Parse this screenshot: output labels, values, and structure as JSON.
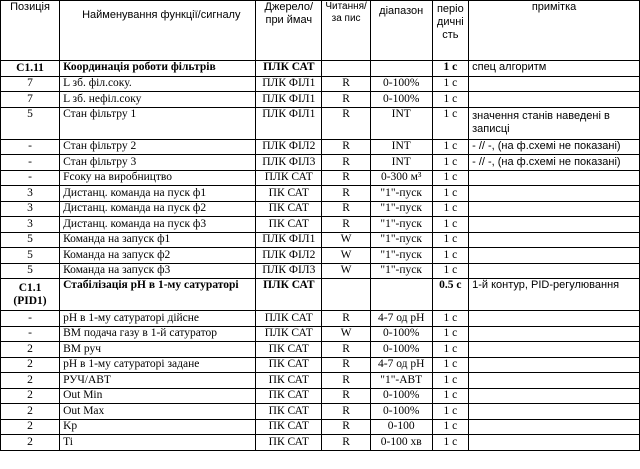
{
  "headers": {
    "position": "Позиція",
    "name": "Найменування функції/сигналу",
    "source": "Джерело/при ймач",
    "rw": "Читання/за пис",
    "range": "діапазон",
    "period": "періо дичні сть",
    "note": "примітка"
  },
  "rows": [
    {
      "pos": "С1.11",
      "name": "Координація роботи фільтрів",
      "src": "ПЛК САТ",
      "rw": "",
      "range": "",
      "per": "1 с",
      "note": "спец алгоритм",
      "section": true
    },
    {
      "pos": "7",
      "name": "L зб. філ.соку.",
      "src": "ПЛК ФІЛ1",
      "rw": "R",
      "range": "0-100%",
      "per": "1 с",
      "note": ""
    },
    {
      "pos": "7",
      "name": "L зб. нефіл.соку",
      "src": "ПЛК ФІЛ1",
      "rw": "R",
      "range": "0-100%",
      "per": "1 с",
      "note": ""
    },
    {
      "pos": "5",
      "name": "Стан фільтру 1",
      "src": "ПЛК ФІЛ1",
      "rw": "R",
      "range": "INT",
      "per": "1 с",
      "note": "значення станів наведені в записці",
      "tall": true
    },
    {
      "pos": "-",
      "name": "Стан фільтру 2",
      "src": "ПЛК ФІЛ2",
      "rw": "R",
      "range": "INT",
      "per": "1 с",
      "note": "- // -, (на ф.схемі не показані)"
    },
    {
      "pos": "-",
      "name": "Стан фільтру 3",
      "src": "ПЛК ФІЛ3",
      "rw": "R",
      "range": "INT",
      "per": "1 с",
      "note": "- // -, (на ф.схемі не показані)"
    },
    {
      "pos": "-",
      "name": "Fсоку на виробництво",
      "src": "ПЛК САТ",
      "rw": "R",
      "range": "0-300 м³",
      "per": "1 с",
      "note": ""
    },
    {
      "pos": "3",
      "name": "Дистанц. команда на пуск ф1",
      "src": "ПК САТ",
      "rw": "R",
      "range": "\"1\"-пуск",
      "per": "1 с",
      "note": ""
    },
    {
      "pos": "3",
      "name": "Дистанц. команда на пуск ф2",
      "src": "ПК САТ",
      "rw": "R",
      "range": "\"1\"-пуск",
      "per": "1 с",
      "note": ""
    },
    {
      "pos": "3",
      "name": "Дистанц. команда на пуск ф3",
      "src": "ПК САТ",
      "rw": "R",
      "range": "\"1\"-пуск",
      "per": "1 с",
      "note": ""
    },
    {
      "pos": "5",
      "name": "Команда на запуск ф1",
      "src": "ПЛК ФІЛ1",
      "rw": "W",
      "range": "\"1\"-пуск",
      "per": "1 с",
      "note": ""
    },
    {
      "pos": "5",
      "name": "Команда на запуск ф2",
      "src": "ПЛК ФІЛ2",
      "rw": "W",
      "range": "\"1\"-пуск",
      "per": "1 с",
      "note": ""
    },
    {
      "pos": "5",
      "name": "Команда на запуск ф3",
      "src": "ПЛК ФІЛ3",
      "rw": "W",
      "range": "\"1\"-пуск",
      "per": "1 с",
      "note": ""
    },
    {
      "pos": "С1.1 (PID1)",
      "name": "Стабілізація pH в 1-му сатураторі",
      "src": "ПЛК САТ",
      "rw": "",
      "range": "",
      "per": "0.5 с",
      "note": "1-й контур, PID-регулювання",
      "section": true,
      "tall": true
    },
    {
      "pos": "-",
      "name": "pH в 1-му сатураторі дійсне",
      "src": "ПЛК САТ",
      "rw": "R",
      "range": "4-7 од pH",
      "per": "1 с",
      "note": ""
    },
    {
      "pos": "-",
      "name": "ВМ подача газу в 1-й сатуратор",
      "src": "ПЛК САТ",
      "rw": "W",
      "range": "0-100%",
      "per": "1 с",
      "note": ""
    },
    {
      "pos": "2",
      "name": "ВМ руч",
      "src": "ПК САТ",
      "rw": "R",
      "range": "0-100%",
      "per": "1 с",
      "note": ""
    },
    {
      "pos": "2",
      "name": "pH в 1-му сатураторі задане",
      "src": "ПК САТ",
      "rw": "R",
      "range": "4-7 од pH",
      "per": "1 с",
      "note": ""
    },
    {
      "pos": "2",
      "name": "РУЧ/АВТ",
      "src": "ПК САТ",
      "rw": "R",
      "range": "\"1\"-АВТ",
      "per": "1 с",
      "note": ""
    },
    {
      "pos": "2",
      "name": "Out Min",
      "src": "ПК САТ",
      "rw": "R",
      "range": "0-100%",
      "per": "1 с",
      "note": ""
    },
    {
      "pos": "2",
      "name": "Out Max",
      "src": "ПК САТ",
      "rw": "R",
      "range": "0-100%",
      "per": "1 с",
      "note": ""
    },
    {
      "pos": "2",
      "name": "Kp",
      "src": "ПК САТ",
      "rw": "R",
      "range": "0-100",
      "per": "1 с",
      "note": ""
    },
    {
      "pos": "2",
      "name": "Ti",
      "src": "ПК САТ",
      "rw": "R",
      "range": "0-100 хв",
      "per": "1 с",
      "note": ""
    }
  ]
}
